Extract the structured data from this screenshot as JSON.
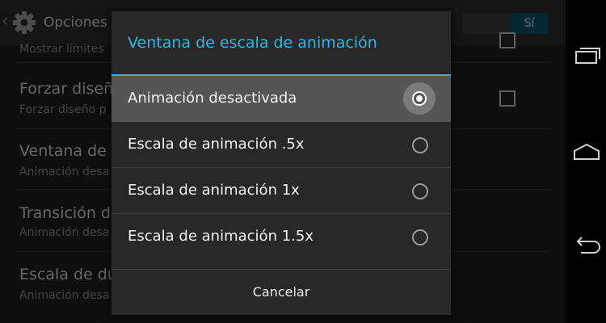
{
  "settings": {
    "title": "Opciones",
    "switch_label": "Sí",
    "items": [
      {
        "title": "",
        "summary": "Mostrar límites"
      },
      {
        "title": "Forzar diseñ",
        "summary": "Forzar diseño p"
      },
      {
        "title": "Ventana de",
        "summary": "Animación desa"
      },
      {
        "title": "Transición d",
        "summary": "Animación desa"
      },
      {
        "title": "Escala de du",
        "summary": "Animación desa"
      }
    ]
  },
  "dialog": {
    "title": "Ventana de escala de animación",
    "options": [
      {
        "label": "Animación desactivada",
        "selected": true
      },
      {
        "label": "Escala de animación .5x",
        "selected": false
      },
      {
        "label": "Escala de animación 1x",
        "selected": false
      },
      {
        "label": "Escala de animación 1.5x",
        "selected": false
      }
    ],
    "cancel_label": "Cancelar"
  },
  "icons": {
    "back": "back-chevron-icon",
    "settings": "gear-icon",
    "recents": "recent-apps-icon",
    "home": "home-icon",
    "nav_back": "back-arrow-icon"
  },
  "colors": {
    "accent": "#33b5e5",
    "switch_on": "#0f4f6e"
  }
}
